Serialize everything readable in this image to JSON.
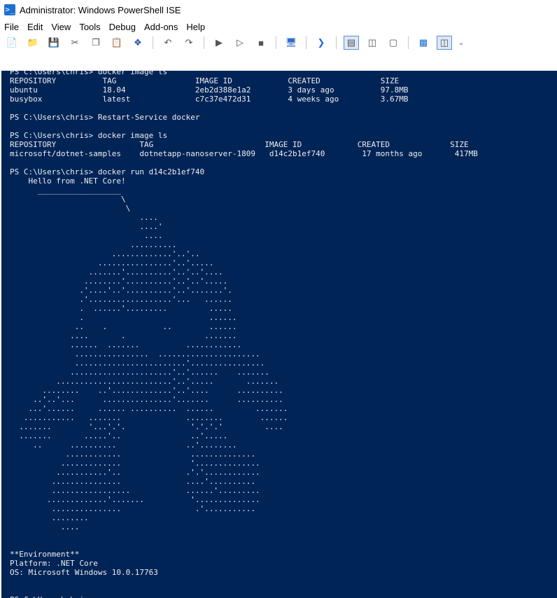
{
  "window": {
    "title": "Administrator: Windows PowerShell ISE",
    "icon": "powershell-icon"
  },
  "menu": [
    "File",
    "Edit",
    "View",
    "Tools",
    "Debug",
    "Add-ons",
    "Help"
  ],
  "toolbar": {
    "buttons": [
      "new-script-icon",
      "open-icon",
      "save-icon",
      "cut-icon",
      "copy-icon",
      "paste-icon",
      "clear-console-icon",
      "undo-icon",
      "redo-icon",
      "run-icon",
      "run-selection-icon",
      "stop-icon",
      "remote-powershell-icon",
      "start-powershell-icon",
      "show-script-top-icon",
      "show-script-right-icon",
      "show-script-max-icon",
      "show-command-window-icon",
      "show-command-addon-icon",
      "toolbar-overflow-icon"
    ]
  },
  "console": {
    "background": "#012456",
    "foreground": "#eeedf0",
    "text": "PS C:\\Users\\chris> docker image ls\nREPOSITORY          TAG                 IMAGE ID            CREATED             SIZE\nubuntu              18.04               2eb2d388e1a2        3 days ago          97.8MB\nbusybox             latest              c7c37e472d31        4 weeks ago         3.67MB\n\nPS C:\\Users\\chris> Restart-Service docker\n\nPS C:\\Users\\chris> docker image ls\nREPOSITORY                  TAG                        IMAGE ID            CREATED             SIZE\nmicrosoft/dotnet-samples    dotnetapp-nanoserver-1809   d14c2b1ef740        17 months ago       417MB\n\nPS C:\\Users\\chris> docker run d14c2b1ef740\n    Hello from .NET Core!\n      __________________\n                        \\\n                         \\\n                            ....\n                            ....'\n                             ....\n                          ..........\n                      .............'..'..\n                   ................'..'.....\n                 .......'..........'..'..'....\n                ........'..........'..'..'.....\n               .'....'..'..........'..'.......'.\n               .'..................'...   ......\n               .  ......'.........         .....\n               .                           ......\n              ..    .            ..        ......\n             ....       .                 .......\n             ......  .......          ............\n              ................  ......................\n              ........................'................\n             ......................'..'......    .......\n          .........................'..'.....       .......\n       ........    ..'.............'..'....      ..........\n     ..'..'...      ...............'.......      ..........\n    ...'......     ...... ..........  ......         .......\n   ...........   .......              ........        ......\n  .......        '...'.'.              '.'.'.'         ....\n  .......       .....'..               ..'.....\n     ..      ..........               ..'........\n            ............               ..............\n           .............               '..............\n          ...........'..              .'.'............\n         ...............              ....'..........\n         .................            ......'.........\n        .............'.......          '..............\n         ...............                .'...........\n         ........\n           ....\n\n\n**Environment**\nPlatform: .NET Core\nOS: Microsoft Windows 10.0.17763\n\n\nPS C:\\Users\\chris>"
  }
}
